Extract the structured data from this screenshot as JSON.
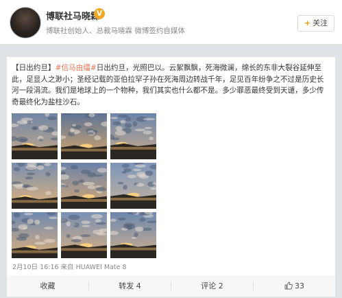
{
  "profile": {
    "name": "博联社马晓霖",
    "verify_badge": "V",
    "description": "博联社创始人、总裁马晓霖 微博签约自媒体",
    "follow_label": "关注",
    "follow_plus": "+"
  },
  "post": {
    "tag_open": "【日出约旦】",
    "topic": "#信马由缰#",
    "body": "日出约旦，光照巴以。云絮飘飘，死海微澜，绵长的东非大裂谷延伸至此，足显人之渺小；圣经记载的亚伯拉罕子孙在死海周边转战千年，足见百年纷争之不过是历史长河一段涓流。我们是地球上的一个物种，我们其实也什么都不是。多少罪恶最终受到天谴，多少传奇最终化为盐柱沙石。",
    "meta": "2月10日 16:16 来自 HUAWEI Mate 8",
    "photos": [
      {
        "scene": "sunrise-clouds-1"
      },
      {
        "scene": "sunrise-clouds-2"
      },
      {
        "scene": "sunrise-clouds-3"
      },
      {
        "scene": "sunrise-clouds-4"
      },
      {
        "scene": "sunrise-clouds-5"
      },
      {
        "scene": "sunrise-clouds-6"
      },
      {
        "scene": "sunrise-clouds-7"
      },
      {
        "scene": "sunrise-clouds-8"
      },
      {
        "scene": "sunrise-clouds-9"
      }
    ]
  },
  "actions": {
    "favorite_label": "收藏",
    "repost_label": "转发 4",
    "comment_label": "评论 2",
    "like_count": "33",
    "like_icon": "thumbs-up-icon"
  },
  "colors": {
    "topic": "#eb7350",
    "badge": "#f5a623",
    "follow_plus": "#f39800"
  }
}
